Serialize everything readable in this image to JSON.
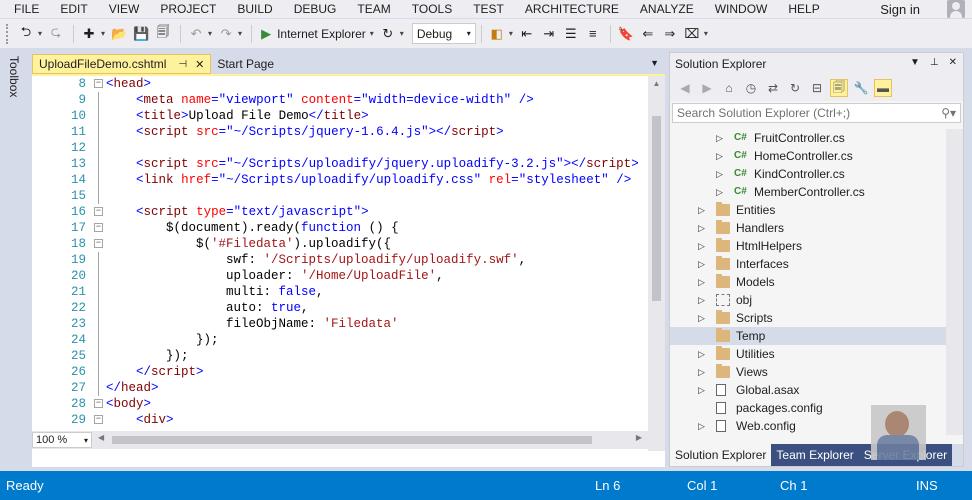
{
  "menu": [
    "FILE",
    "EDIT",
    "VIEW",
    "PROJECT",
    "BUILD",
    "DEBUG",
    "TEAM",
    "TOOLS",
    "TEST",
    "ARCHITECTURE",
    "ANALYZE",
    "WINDOW",
    "HELP"
  ],
  "signin": "Sign in",
  "toolbar": {
    "run_label": "Internet Explorer",
    "configuration": "Debug"
  },
  "toolbox_label": "Toolbox",
  "tabs": [
    {
      "label": "UploadFileDemo.cshtml",
      "active": true
    },
    {
      "label": "Start Page",
      "active": false
    }
  ],
  "zoom": "100 %",
  "code_lines": [
    {
      "n": "8",
      "fold": "−",
      "segs": [
        [
          "punc",
          "<"
        ],
        [
          "tag",
          "head"
        ],
        [
          "punc",
          ">"
        ]
      ]
    },
    {
      "n": "9",
      "segs": [
        [
          "txt",
          "    "
        ],
        [
          "punc",
          "<"
        ],
        [
          "tag",
          "meta"
        ],
        [
          "txt",
          " "
        ],
        [
          "attr",
          "name"
        ],
        [
          "punc",
          "="
        ],
        [
          "aval",
          "\"viewport\""
        ],
        [
          "txt",
          " "
        ],
        [
          "attr",
          "content"
        ],
        [
          "punc",
          "="
        ],
        [
          "aval",
          "\"width=device-width\""
        ],
        [
          "txt",
          " "
        ],
        [
          "punc",
          "/>"
        ]
      ]
    },
    {
      "n": "10",
      "segs": [
        [
          "txt",
          "    "
        ],
        [
          "punc",
          "<"
        ],
        [
          "tag",
          "title"
        ],
        [
          "punc",
          ">"
        ],
        [
          "txt",
          "Upload File Demo"
        ],
        [
          "punc",
          "</"
        ],
        [
          "tag",
          "title"
        ],
        [
          "punc",
          ">"
        ]
      ]
    },
    {
      "n": "11",
      "segs": [
        [
          "txt",
          "    "
        ],
        [
          "punc",
          "<"
        ],
        [
          "tag",
          "script"
        ],
        [
          "txt",
          " "
        ],
        [
          "attr",
          "src"
        ],
        [
          "punc",
          "="
        ],
        [
          "aval",
          "\"~/Scripts/jquery-1.6.4.js\""
        ],
        [
          "punc",
          "></"
        ],
        [
          "tag",
          "script"
        ],
        [
          "punc",
          ">"
        ]
      ]
    },
    {
      "n": "12",
      "segs": []
    },
    {
      "n": "13",
      "segs": [
        [
          "txt",
          "    "
        ],
        [
          "punc",
          "<"
        ],
        [
          "tag",
          "script"
        ],
        [
          "txt",
          " "
        ],
        [
          "attr",
          "src"
        ],
        [
          "punc",
          "="
        ],
        [
          "aval",
          "\"~/Scripts/uploadify/jquery.uploadify-3.2.js\""
        ],
        [
          "punc",
          "></"
        ],
        [
          "tag",
          "script"
        ],
        [
          "punc",
          ">"
        ]
      ]
    },
    {
      "n": "14",
      "segs": [
        [
          "txt",
          "    "
        ],
        [
          "punc",
          "<"
        ],
        [
          "tag",
          "link"
        ],
        [
          "txt",
          " "
        ],
        [
          "attr",
          "href"
        ],
        [
          "punc",
          "="
        ],
        [
          "aval",
          "\"~/Scripts/uploadify/uploadify.css\""
        ],
        [
          "txt",
          " "
        ],
        [
          "attr",
          "rel"
        ],
        [
          "punc",
          "="
        ],
        [
          "aval",
          "\"stylesheet\""
        ],
        [
          "txt",
          " "
        ],
        [
          "punc",
          "/>"
        ]
      ]
    },
    {
      "n": "15",
      "segs": []
    },
    {
      "n": "16",
      "fold": "−",
      "segs": [
        [
          "txt",
          "    "
        ],
        [
          "punc",
          "<"
        ],
        [
          "tag",
          "script"
        ],
        [
          "txt",
          " "
        ],
        [
          "attr",
          "type"
        ],
        [
          "punc",
          "="
        ],
        [
          "aval",
          "\"text/javascript\""
        ],
        [
          "punc",
          ">"
        ]
      ]
    },
    {
      "n": "17",
      "fold": "−",
      "segs": [
        [
          "txt",
          "        $(document).ready("
        ],
        [
          "kw",
          "function"
        ],
        [
          "txt",
          " () {"
        ]
      ]
    },
    {
      "n": "18",
      "fold": "−",
      "segs": [
        [
          "txt",
          "            $("
        ],
        [
          "str",
          "'#Filedata'"
        ],
        [
          "txt",
          ").uploadify({"
        ]
      ]
    },
    {
      "n": "19",
      "segs": [
        [
          "txt",
          "                swf: "
        ],
        [
          "str",
          "'/Scripts/uploadify/uploadify.swf'"
        ],
        [
          "txt",
          ","
        ]
      ]
    },
    {
      "n": "20",
      "segs": [
        [
          "txt",
          "                uploader: "
        ],
        [
          "str",
          "'/Home/UploadFile'"
        ],
        [
          "txt",
          ","
        ]
      ]
    },
    {
      "n": "21",
      "segs": [
        [
          "txt",
          "                multi: "
        ],
        [
          "kw",
          "false"
        ],
        [
          "txt",
          ","
        ]
      ]
    },
    {
      "n": "22",
      "segs": [
        [
          "txt",
          "                auto: "
        ],
        [
          "kw",
          "true"
        ],
        [
          "txt",
          ","
        ]
      ]
    },
    {
      "n": "23",
      "segs": [
        [
          "txt",
          "                fileObjName: "
        ],
        [
          "str",
          "'Filedata'"
        ]
      ]
    },
    {
      "n": "24",
      "segs": [
        [
          "txt",
          "            });"
        ]
      ]
    },
    {
      "n": "25",
      "segs": [
        [
          "txt",
          "        });"
        ]
      ]
    },
    {
      "n": "26",
      "segs": [
        [
          "txt",
          "    "
        ],
        [
          "punc",
          "</"
        ],
        [
          "tag",
          "script"
        ],
        [
          "punc",
          ">"
        ]
      ]
    },
    {
      "n": "27",
      "segs": [
        [
          "punc",
          "</"
        ],
        [
          "tag",
          "head"
        ],
        [
          "punc",
          ">"
        ]
      ]
    },
    {
      "n": "28",
      "fold": "−",
      "segs": [
        [
          "punc",
          "<"
        ],
        [
          "tag",
          "body"
        ],
        [
          "punc",
          ">"
        ]
      ]
    },
    {
      "n": "29",
      "fold": "−",
      "segs": [
        [
          "txt",
          "    "
        ],
        [
          "punc",
          "<"
        ],
        [
          "tag",
          "div"
        ],
        [
          "punc",
          ">"
        ]
      ]
    }
  ],
  "solution_explorer": {
    "title": "Solution Explorer",
    "search_placeholder": "Search Solution Explorer (Ctrl+;)",
    "items": [
      {
        "label": "FruitController.cs",
        "icon": "cs",
        "level": 2,
        "expander": true
      },
      {
        "label": "HomeController.cs",
        "icon": "cs",
        "level": 2,
        "expander": true
      },
      {
        "label": "KindController.cs",
        "icon": "cs",
        "level": 2,
        "expander": true
      },
      {
        "label": "MemberController.cs",
        "icon": "cs",
        "level": 2,
        "expander": true
      },
      {
        "label": "Entities",
        "icon": "folder",
        "level": 1,
        "expander": true
      },
      {
        "label": "Handlers",
        "icon": "folder",
        "level": 1,
        "expander": true
      },
      {
        "label": "HtmlHelpers",
        "icon": "folder",
        "level": 1,
        "expander": true
      },
      {
        "label": "Interfaces",
        "icon": "folder",
        "level": 1,
        "expander": true
      },
      {
        "label": "Models",
        "icon": "folder",
        "level": 1,
        "expander": true
      },
      {
        "label": "obj",
        "icon": "dashed",
        "level": 1,
        "expander": true
      },
      {
        "label": "Scripts",
        "icon": "folder",
        "level": 1,
        "expander": true
      },
      {
        "label": "Temp",
        "icon": "folder",
        "level": 1,
        "expander": false,
        "state": "selected"
      },
      {
        "label": "Utilities",
        "icon": "folder",
        "level": 1,
        "expander": true
      },
      {
        "label": "Views",
        "icon": "folder",
        "level": 1,
        "expander": true
      },
      {
        "label": "Global.asax",
        "icon": "file",
        "level": 1,
        "expander": true
      },
      {
        "label": "packages.config",
        "icon": "file",
        "level": 1,
        "expander": false
      },
      {
        "label": "Web.config",
        "icon": "file",
        "level": 1,
        "expander": true
      }
    ],
    "tabs": [
      "Solution Explorer",
      "Team Explorer",
      "Server Explorer"
    ]
  },
  "status": {
    "ready": "Ready",
    "ln": "Ln 6",
    "col": "Col 1",
    "ch": "Ch 1",
    "ins": "INS"
  }
}
